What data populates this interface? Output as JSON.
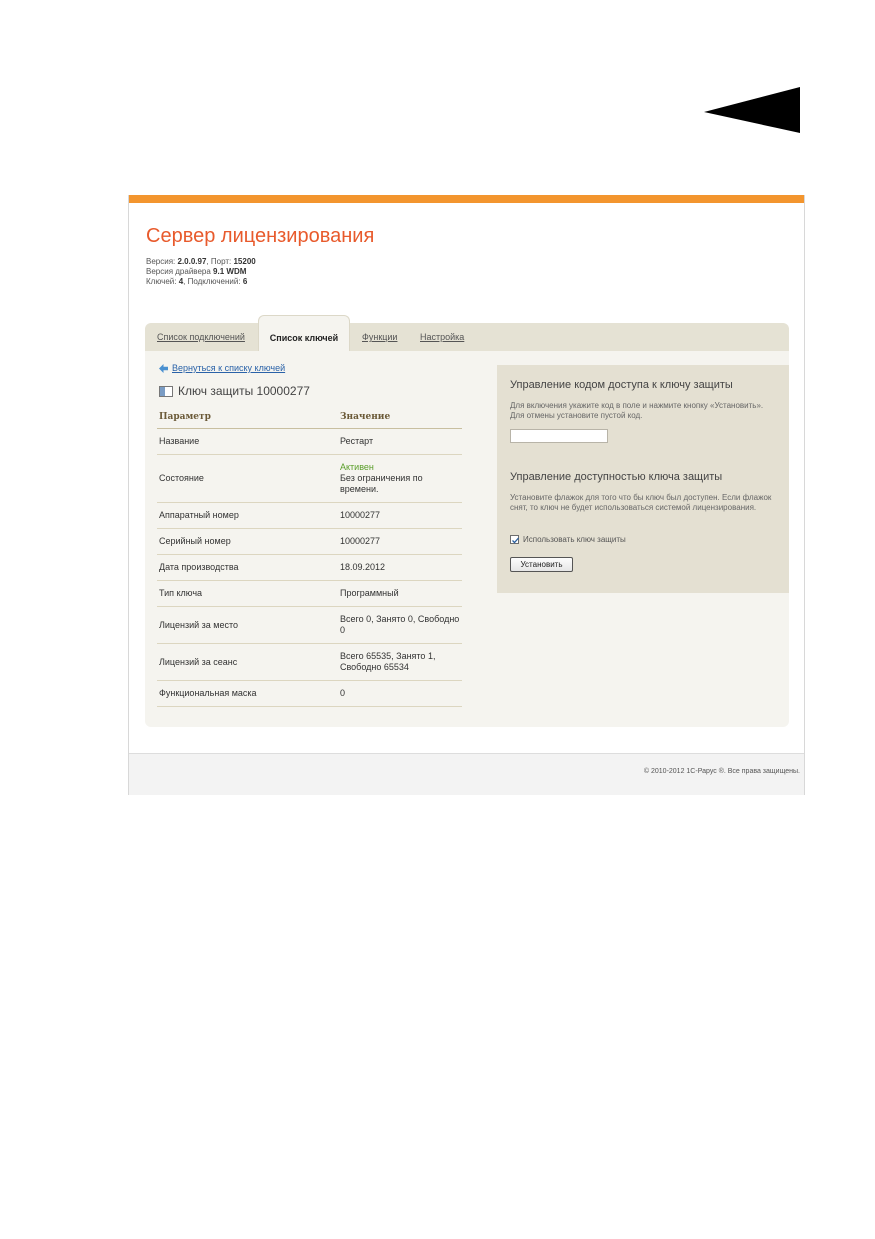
{
  "app": {
    "title": "Сервер лицензирования",
    "version_label": "Версия:",
    "version": "2.0.0.97",
    "port_label": "Порт:",
    "port": "15200",
    "driver_label": "Версия драйвера",
    "driver": "9.1 WDM",
    "keys_label": "Ключей:",
    "keys": "4",
    "connections_label": "Подключений:",
    "connections": "6"
  },
  "tabs": [
    {
      "label": "Список подключений",
      "active": false
    },
    {
      "label": "Список ключей",
      "active": true
    },
    {
      "label": "Функции",
      "active": false
    },
    {
      "label": "Настройка",
      "active": false
    }
  ],
  "key": {
    "back_link": "Вернуться к списку ключей",
    "title": "Ключ защиты 10000277",
    "header_param": "Параметр",
    "header_value": "Значение",
    "rows": [
      {
        "param": "Название",
        "value": "Рестарт"
      },
      {
        "param": "Состояние",
        "status": "Активен",
        "value": "Без ограничения по времени."
      },
      {
        "param": "Аппаратный номер",
        "value": "10000277"
      },
      {
        "param": "Серийный номер",
        "value": "10000277"
      },
      {
        "param": "Дата производства",
        "value": "18.09.2012"
      },
      {
        "param": "Тип ключа",
        "value": "Программный"
      },
      {
        "param": "Лицензий за место",
        "value": "Всего 0, Занято 0, Свободно 0"
      },
      {
        "param": "Лицензий за сеанс",
        "value": "Всего 65535, Занято 1, Свободно 65534"
      },
      {
        "param": "Функциональная маска",
        "value": "0"
      }
    ]
  },
  "access": {
    "heading": "Управление кодом доступа к ключу защиты",
    "description": "Для включения укажите код в поле и нажмите кнопку «Установить». Для отмены установите пустой код.",
    "code_value": ""
  },
  "availability": {
    "heading": "Управление доступностью ключа защиты",
    "description": "Установите флажок для того что бы ключ был доступен. Если флажок снят, то ключ не будет использоваться системой лицензирования.",
    "checkbox_label": "Использовать ключ защиты",
    "checked": true,
    "button_label": "Установить"
  },
  "footer": {
    "copyright": "© 2010-2012 1С-Рарус ®. Все права защищены."
  },
  "colors": {
    "accent": "#f3952e",
    "title": "#e85a2c",
    "link": "#2a62a8",
    "status_active": "#5a9e2a"
  }
}
